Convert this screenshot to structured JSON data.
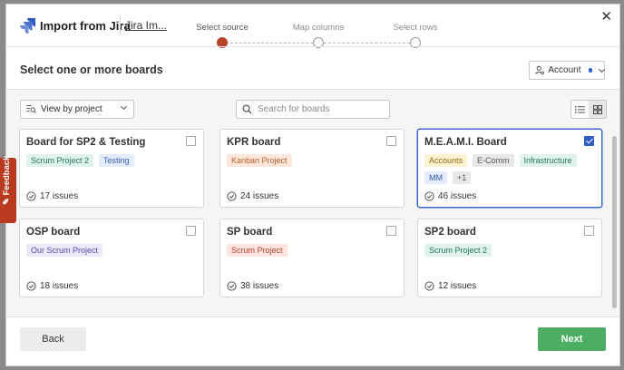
{
  "header": {
    "title": "Import from Jira",
    "site_link": "Jira Im...",
    "steps": [
      {
        "label": "Select source",
        "active": true
      },
      {
        "label": "Map columns",
        "active": false
      },
      {
        "label": "Select rows",
        "active": false
      }
    ]
  },
  "section": {
    "title": "Select one or more boards",
    "account_label": "Account"
  },
  "filters": {
    "view_by": "View by project",
    "search_placeholder": "Search for boards"
  },
  "boards": [
    {
      "title": "Board for SP2 & Testing",
      "tags": [
        {
          "text": "Scrum Project 2",
          "color": "green"
        },
        {
          "text": "Testing",
          "color": "blue"
        }
      ],
      "issues": "17 issues",
      "selected": false
    },
    {
      "title": "KPR board",
      "tags": [
        {
          "text": "Kanban Project",
          "color": "orange"
        }
      ],
      "issues": "24 issues",
      "selected": false
    },
    {
      "title": "M.E.A.M.I. Board",
      "tags": [
        {
          "text": "Accounts",
          "color": "yellow"
        },
        {
          "text": "E-Comm",
          "color": "gray"
        },
        {
          "text": "Infrastructure",
          "color": "green"
        },
        {
          "text": "MM",
          "color": "blue"
        },
        {
          "text": "+1",
          "color": "gray"
        }
      ],
      "issues": "46 issues",
      "selected": true
    },
    {
      "title": "OSP board",
      "tags": [
        {
          "text": "Our Scrum Project",
          "color": "purple"
        }
      ],
      "issues": "18 issues",
      "selected": false
    },
    {
      "title": "SP board",
      "tags": [
        {
          "text": "Scrum Project",
          "color": "red"
        }
      ],
      "issues": "38 issues",
      "selected": false
    },
    {
      "title": "SP2 board",
      "tags": [
        {
          "text": "Scrum Project 2",
          "color": "green"
        }
      ],
      "issues": "12 issues",
      "selected": false
    }
  ],
  "feedback_label": "Feedback",
  "footer": {
    "back_label": "Back",
    "next_label": "Next"
  },
  "colors": {
    "accent": "#b5452a",
    "primary_action": "#4cae62",
    "selected_border": "#3a67c9"
  }
}
